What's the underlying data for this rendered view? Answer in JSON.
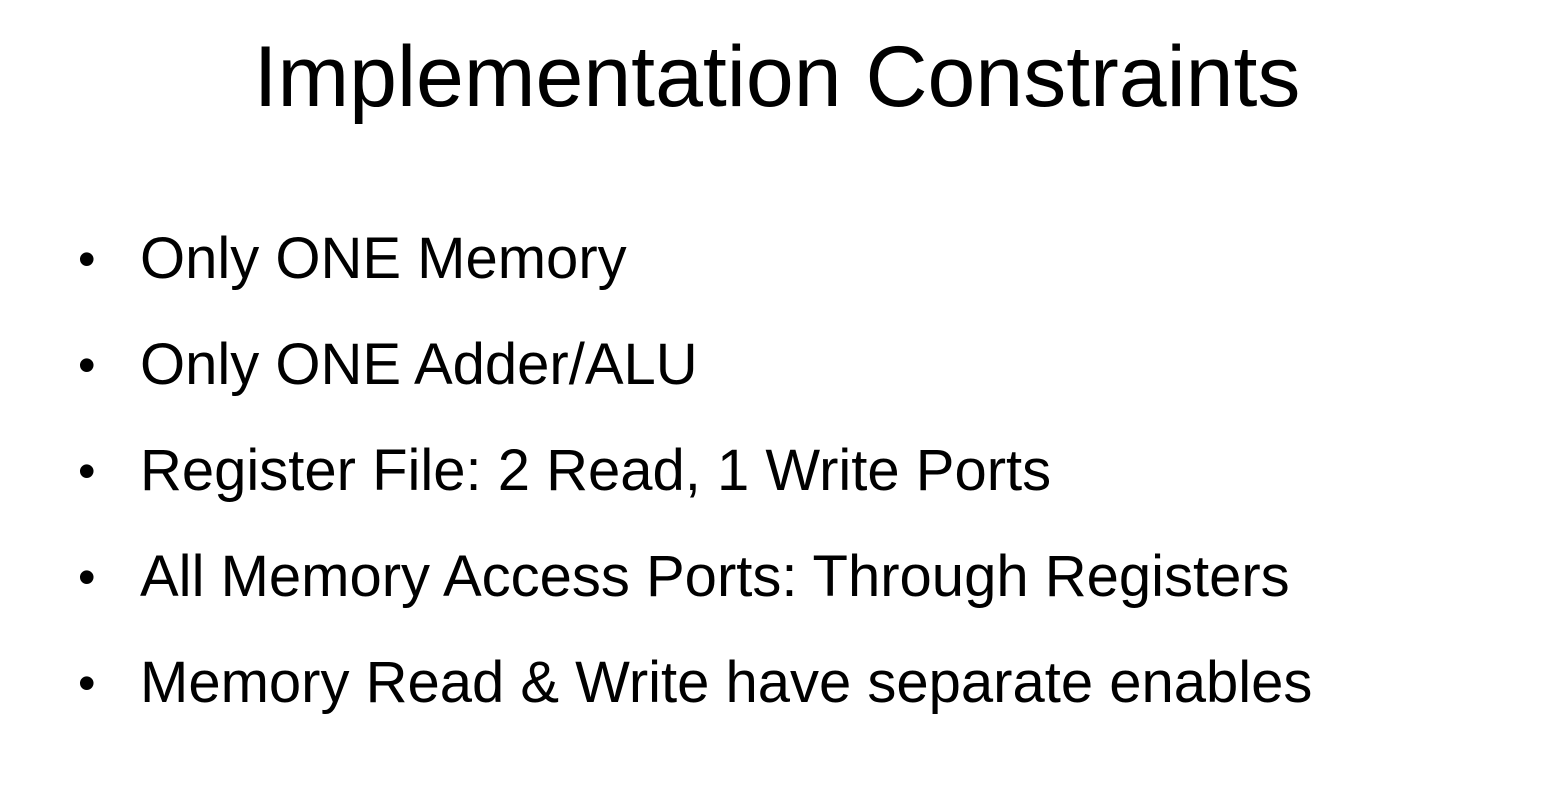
{
  "slide": {
    "title": "Implementation Constraints",
    "bullet_glyph": "•",
    "bullets": [
      "Only ONE Memory",
      "Only ONE Adder/ALU",
      "Register File: 2 Read, 1 Write Ports",
      "All Memory Access Ports: Through Registers",
      "Memory Read & Write have separate enables"
    ]
  }
}
